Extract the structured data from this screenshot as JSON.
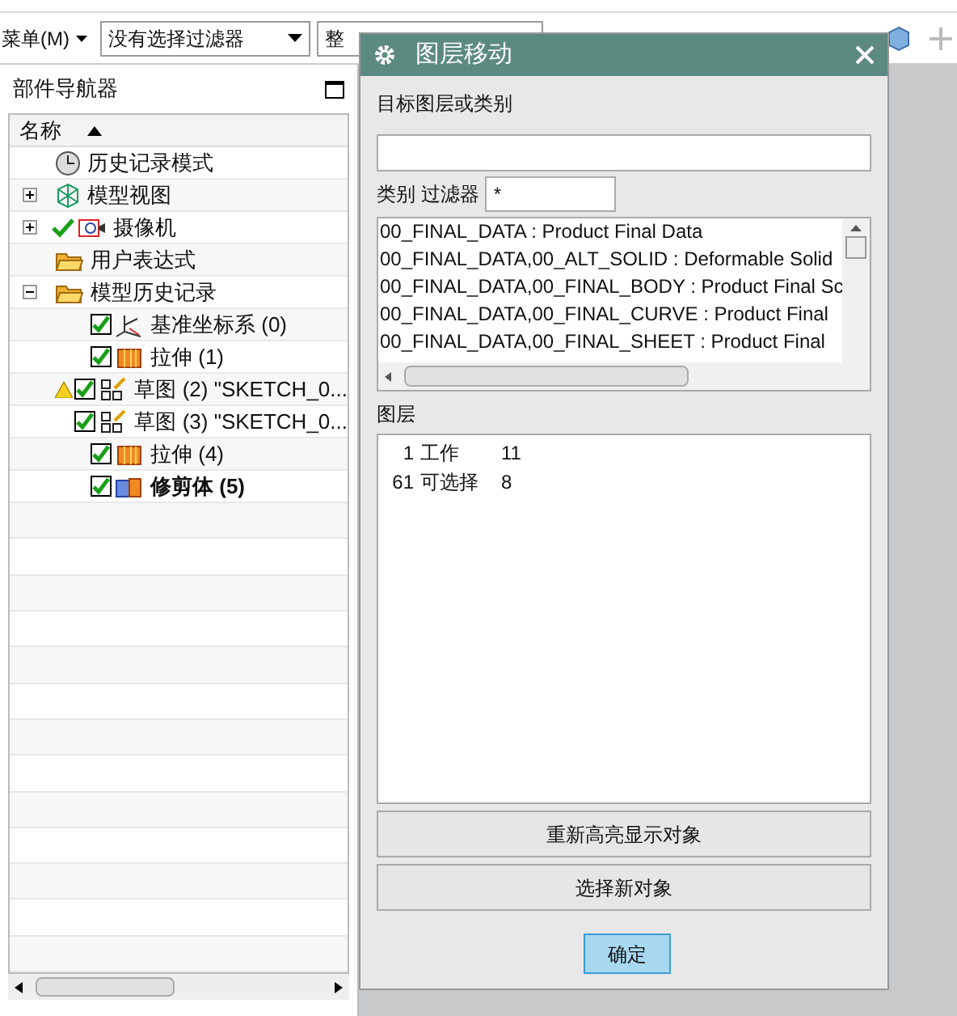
{
  "toolbar": {
    "menu": "菜单(M)",
    "filter_dropdown": "没有选择过滤器",
    "scope_dropdown": "整"
  },
  "navigator": {
    "title": "部件导航器",
    "column": "名称",
    "items": [
      {
        "label": "历史记录模式",
        "kind": "clock"
      },
      {
        "label": "模型视图",
        "kind": "views",
        "expanded": false
      },
      {
        "label": "摄像机",
        "kind": "camera",
        "expanded": false,
        "checked": true
      },
      {
        "label": "用户表达式",
        "kind": "folder"
      },
      {
        "label": "模型历史记录",
        "kind": "folder",
        "expanded": true,
        "children": [
          {
            "label": "基准坐标系 (0)",
            "kind": "csys",
            "checked": true,
            "warning": false,
            "current": false
          },
          {
            "label": "拉伸 (1)",
            "kind": "extrude",
            "checked": true,
            "warning": false,
            "current": false
          },
          {
            "label": "草图 (2) \"SKETCH_0...",
            "kind": "sketch",
            "checked": true,
            "warning": true,
            "current": false
          },
          {
            "label": "草图 (3) \"SKETCH_0...",
            "kind": "sketch",
            "checked": true,
            "warning": false,
            "current": false
          },
          {
            "label": "拉伸 (4)",
            "kind": "extrude",
            "checked": true,
            "warning": false,
            "current": false
          },
          {
            "label": "修剪体 (5)",
            "kind": "trim",
            "checked": true,
            "warning": false,
            "current": true
          }
        ]
      }
    ]
  },
  "dialog": {
    "title": "图层移动",
    "target_label": "目标图层或类别",
    "category_filter_label": "类别 过滤器",
    "category_filter_value": "*",
    "categories": [
      "00_FINAL_DATA : Product Final Data",
      "00_FINAL_DATA,00_ALT_SOLID : Deformable Solid",
      "00_FINAL_DATA,00_FINAL_BODY : Product Final Sc",
      "00_FINAL_DATA,00_FINAL_CURVE : Product Final",
      "00_FINAL_DATA,00_FINAL_SHEET : Product Final"
    ],
    "layers_label": "图层",
    "layers": [
      {
        "number": "1",
        "status": "工作",
        "count": "11"
      },
      {
        "number": "61",
        "status": "可选择",
        "count": "8"
      }
    ],
    "buttons": [
      "重新高亮显示对象",
      "选择新对象"
    ],
    "ok": "确定"
  }
}
